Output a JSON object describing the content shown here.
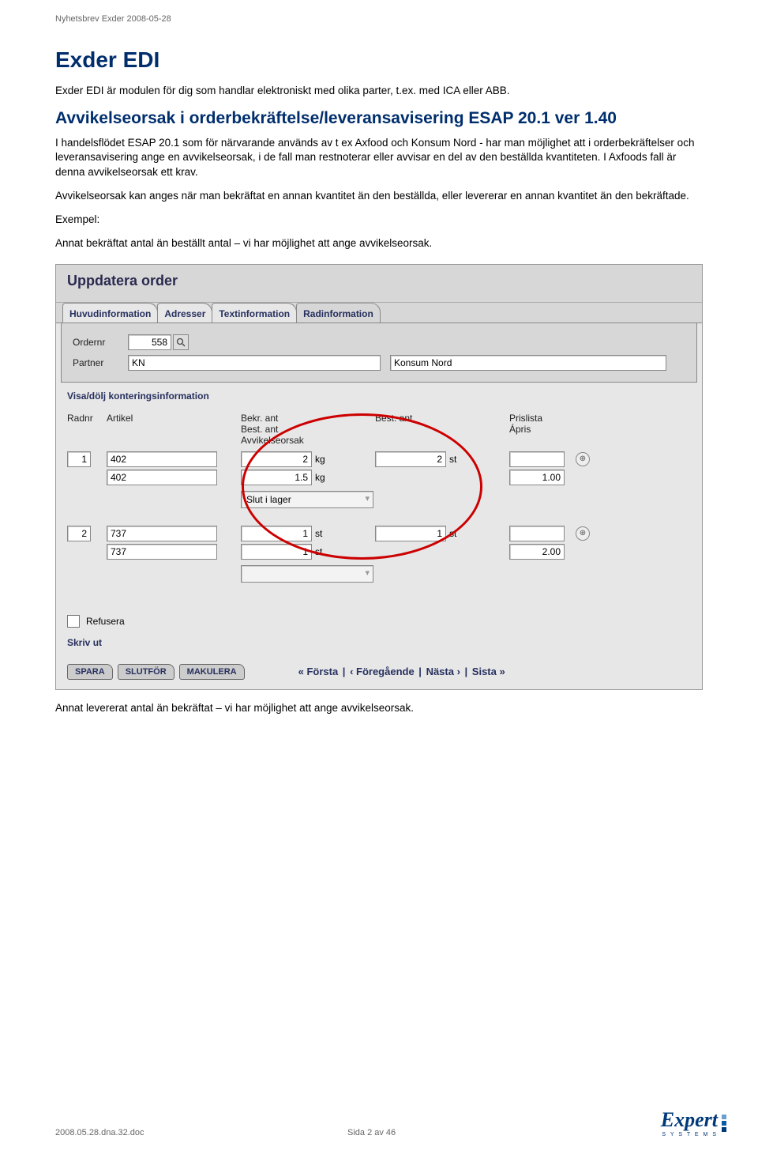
{
  "header": "Nyhetsbrev Exder 2008-05-28",
  "h1": "Exder EDI",
  "p1": "Exder EDI är modulen för dig som handlar elektroniskt med olika parter, t.ex. med ICA eller ABB.",
  "h2": "Avvikelseorsak i orderbekräftelse/leveransavisering ESAP 20.1 ver 1.40",
  "p2": "I handelsflödet ESAP 20.1 som för närvarande används av t ex Axfood och Konsum Nord - har man möjlighet att i orderbekräftelser och leveransavisering ange en avvikelseorsak, i de fall man restnoterar eller avvisar en del av den beställda kvantiteten. I Axfoods fall är denna avvikelseorsak ett krav.",
  "p3": "Avvikelseorsak kan anges när man bekräftat en annan kvantitet än den beställda, eller levererar en annan kvantitet än den bekräftade.",
  "p4": "Exempel:",
  "p5": "Annat bekräftat antal än beställt antal – vi har möjlighet att ange avvikelseorsak.",
  "p6": "Annat levererat antal än bekräftat – vi har möjlighet att ange avvikelseorsak.",
  "screenshot": {
    "title": "Uppdatera order",
    "tabs": [
      "Huvudinformation",
      "Adresser",
      "Textinformation",
      "Radinformation"
    ],
    "active_tab": 3,
    "lbl_ordernr": "Ordernr",
    "val_ordernr": "558",
    "lbl_partner": "Partner",
    "val_partner_code": "KN",
    "val_partner_name": "Konsum Nord",
    "section_link": "Visa/dölj konteringsinformation",
    "col_radnr": "Radnr",
    "col_artikel": "Artikel",
    "col_bekr_line1": "Bekr. ant",
    "col_bekr_line2": "Best. ant",
    "col_bekr_line3": "Avvikelseorsak",
    "col_best2": "Best. ant",
    "col_pris_line1": "Prislista",
    "col_pris_line2": "Ápris",
    "rows": [
      {
        "radnr": "1",
        "artikel1": "402",
        "artikel2": "402",
        "bekr": "2",
        "unit1": "kg",
        "best_inner": "1.5",
        "unit2": "kg",
        "avvik": "Slut i lager",
        "best2": "2",
        "unit3": "st",
        "pris": "",
        "apris": "1.00"
      },
      {
        "radnr": "2",
        "artikel1": "737",
        "artikel2": "737",
        "bekr": "1",
        "unit1": "st",
        "best_inner": "1",
        "unit2": "st",
        "avvik": "",
        "best2": "1",
        "unit3": "st",
        "pris": "",
        "apris": "2.00"
      }
    ],
    "refusera": "Refusera",
    "skrivut": "Skriv ut",
    "buttons": [
      "SPARA",
      "SLUTFÖR",
      "MAKULERA"
    ],
    "pager_first": "« Första",
    "pager_prev": "‹ Föregående",
    "pager_next": "Nästa ›",
    "pager_last": "Sista »"
  },
  "footer_left": "2008.05.28.dna.32.doc",
  "footer_mid": "Sida 2 av 46",
  "logo_text": "Expert",
  "logo_sub": "S Y S T E M S"
}
